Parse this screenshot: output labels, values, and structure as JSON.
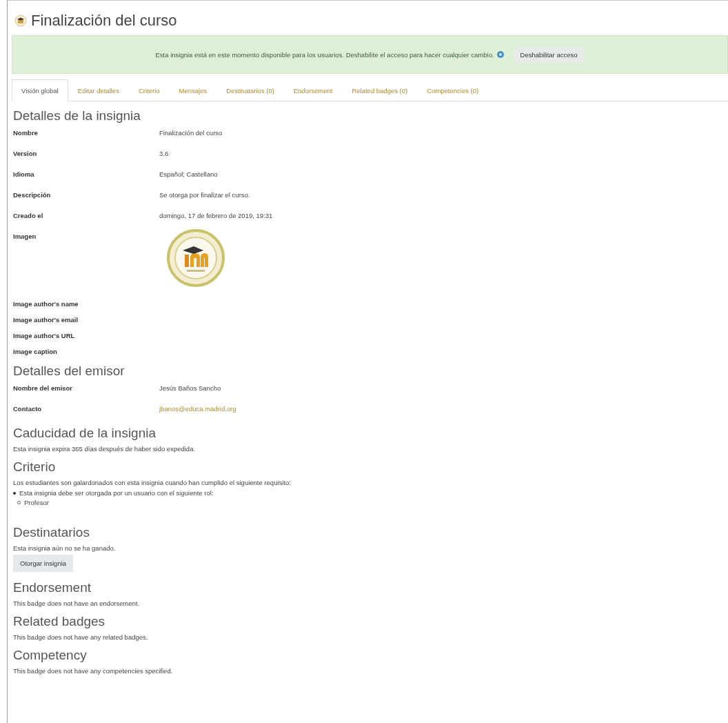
{
  "page_title": "Finalización del curso",
  "alert": {
    "message": "Esta insignia está en este momento disponible para los usuarios. Deshabilite el acceso para hacer cualquier cambio.",
    "button": "Deshabilitar acceso"
  },
  "tabs": [
    {
      "label": "Visión global",
      "selected": true
    },
    {
      "label": "Editar detalles",
      "selected": false
    },
    {
      "label": "Criterio",
      "selected": false
    },
    {
      "label": "Mensajes",
      "selected": false
    },
    {
      "label": "Destinatarios (0)",
      "selected": false
    },
    {
      "label": "Endorsement",
      "selected": false
    },
    {
      "label": "Related badges (0)",
      "selected": false
    },
    {
      "label": "Competencies (0)",
      "selected": false
    }
  ],
  "sections": [
    {
      "kind": "details",
      "heading": "Detalles de la insignia",
      "rows": [
        {
          "kind": "text",
          "label": "Nombre",
          "value": "Finalización del curso"
        },
        {
          "kind": "text",
          "label": "Version",
          "value": "3.6"
        },
        {
          "kind": "text",
          "label": "Idioma",
          "value": "Español; Castellano"
        },
        {
          "kind": "text",
          "label": "Descripción",
          "value": "Se otorga por finalizar el curso."
        },
        {
          "kind": "text",
          "label": "Creado el",
          "value": "domingo, 17 de febrero de 2019, 19:31"
        },
        {
          "label": "Imagen"
        },
        {
          "kind": "empty",
          "label": "Image author's name"
        },
        {
          "kind": "empty",
          "label": "Image author's email"
        },
        {
          "kind": "empty",
          "label": "Image author's URL"
        },
        {
          "kind": "empty",
          "label": "Image caption"
        }
      ]
    },
    {
      "kind": "details",
      "heading": "Detalles del emisor",
      "rows": [
        {
          "kind": "text",
          "label": "Nombre del emisor",
          "value": "Jesús Baños Sancho"
        },
        {
          "kind": "link",
          "label": "Contacto",
          "value": "jbanos@educa.madrid.org"
        }
      ]
    },
    {
      "kind": "paragraph",
      "heading": "Caducidad de la insignia",
      "text": "Esta insignia expira 365 días después de haber sido expedida."
    },
    {
      "kind": "criteria",
      "heading": "Criterio",
      "text": "Los estudiantes son galardonados con esta insignia cuando han cumplido el siguiente requisito:",
      "items": [
        {
          "text": "Esta insignia debe ser otorgada por un usuario con el siguiente rol:",
          "children": [
            {
              "text": "Profesor"
            }
          ]
        }
      ]
    },
    {
      "kind": "recipients",
      "heading": "Destinatarios",
      "text": "Esta insignia aún no se ha ganado.",
      "button": "Otorgar insignia"
    },
    {
      "kind": "paragraph",
      "heading": "Endorsement",
      "text": "This badge does not have an endorsement."
    },
    {
      "kind": "paragraph",
      "heading": "Related badges",
      "text": "This badge does not have any related badges."
    },
    {
      "kind": "paragraph",
      "heading": "Competency",
      "text": "This badge does not have any competencies specified."
    }
  ]
}
